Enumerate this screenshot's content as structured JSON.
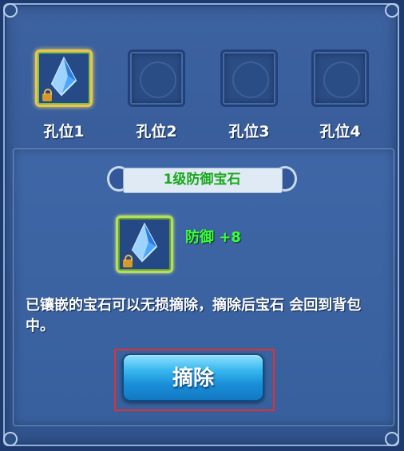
{
  "slots": [
    {
      "label": "孔位1",
      "state": "selected"
    },
    {
      "label": "孔位2",
      "state": "empty"
    },
    {
      "label": "孔位3",
      "state": "empty"
    },
    {
      "label": "孔位4",
      "state": "empty"
    }
  ],
  "gem_panel": {
    "title": "1级防御宝石",
    "stat": "防御 +8",
    "description": "已镶嵌的宝石可以无损摘除，摘除后宝石 会回到背包中。",
    "remove_button": "摘除"
  },
  "colors": {
    "title_text": "#1aa81a",
    "stat_text": "#3cff3c",
    "highlight_border": "#e23030",
    "button_blue": "#1a8fd8"
  }
}
